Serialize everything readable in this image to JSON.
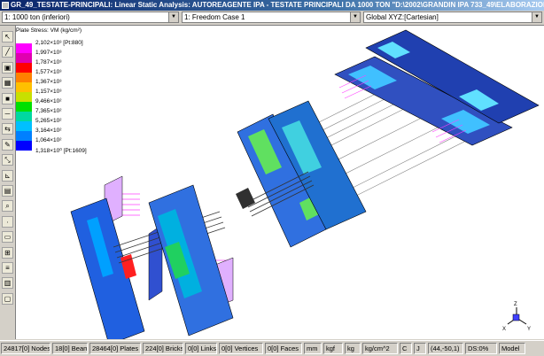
{
  "window": {
    "title": "GR_49_TESTATE-PRINCIPALI: Linear Static Analysis: AUTOREAGENTE IPA - TESTATE PRINCIPALI DA 1000 TON    \"D:\\2002\\GRANDIN IPA 733_49\\ELABORAZIONI FEM\\MO..."
  },
  "combos": {
    "load_case": "1: 1000 ton (inferiori)",
    "freedom_case": "1: Freedom Case 1",
    "coordinate_system": "Global XYZ:[Cartesian]"
  },
  "toolbar": {
    "icons": [
      "pointer-icon",
      "line-icon",
      "node-icon",
      "plate-icon",
      "brick-icon",
      "beam-icon",
      "link-icon",
      "edit-icon",
      "scale-icon",
      "measure-icon",
      "group-icon",
      "zoom-icon",
      "node-list-icon",
      "element-list-icon",
      "tree-icon",
      "attribute-icon",
      "result-icon",
      "window-icon"
    ]
  },
  "legend": {
    "title": "Plate Stress: VM (kg/cm²)",
    "labels": [
      "2,102×10³ [Pt:880]",
      "1,997×10³",
      "1,787×10³",
      "1,577×10³",
      "1,367×10³",
      "1,157×10³",
      "9,466×10²",
      "7,365×10²",
      "5,265×10²",
      "3,164×10²",
      "1,064×10²",
      "1,318×10⁰ [Pt:1609]"
    ],
    "colors": [
      "#ff00ff",
      "#e000b0",
      "#ff0000",
      "#ff8000",
      "#ffc000",
      "#c8e000",
      "#00e000",
      "#00d8a0",
      "#00c0ff",
      "#0080ff",
      "#0000ff"
    ]
  },
  "status_bar": {
    "fields": [
      "24817[0] Nodes",
      "18[0] Beams",
      "28464[0] Plates",
      "224[0] Bricks",
      "0[0] Links",
      "0[0] Vertices",
      "0[0] Faces",
      "mm",
      "kgf",
      "kg",
      "kg/cm^2",
      "C",
      "J",
      "(44,-50,1)",
      "DS:0%",
      "Model"
    ]
  },
  "triad": {
    "x": "X",
    "y": "Y",
    "z": "Z"
  }
}
